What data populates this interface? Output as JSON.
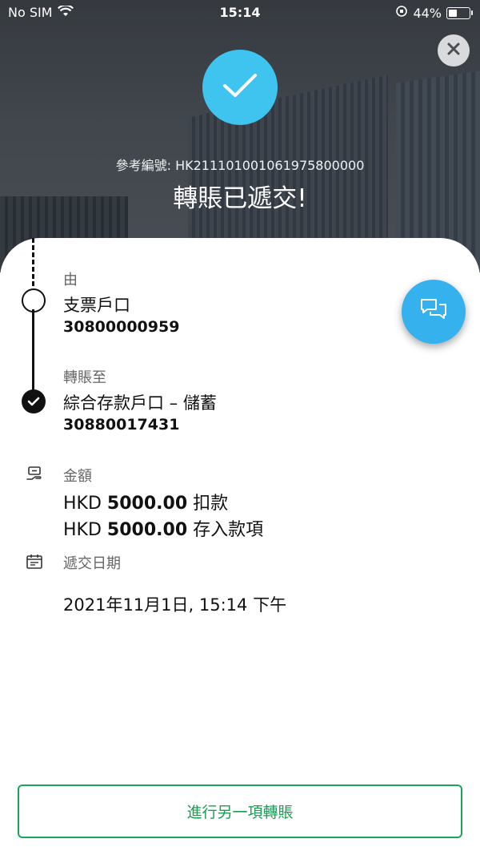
{
  "status_bar": {
    "carrier": "No SIM",
    "time": "15:14",
    "battery_percent": "44%",
    "battery_level": 0.44
  },
  "header": {
    "reference": "參考編號: HK211101001061975800000",
    "title": "轉賬已遞交!"
  },
  "transfer": {
    "from_label": "由",
    "from_account_name": "支票戶口",
    "from_account_number": "30800000959",
    "to_label": "轉賬至",
    "to_account_name": "綜合存款戶口 – 儲蓄",
    "to_account_number": "30880017431"
  },
  "amount": {
    "label": "金額",
    "debit_currency": "HKD",
    "debit_value": "5000.00",
    "debit_suffix": "扣款",
    "credit_currency": "HKD",
    "credit_value": "5000.00",
    "credit_suffix": "存入款項"
  },
  "submission": {
    "label": "遞交日期",
    "datetime": "2021年11月1日, 15:14 下午"
  },
  "actions": {
    "new_transfer": "進行另一項轉賬"
  },
  "colors": {
    "accent_blue": "#3fc3ef",
    "chat_blue": "#35b2ee",
    "action_green": "#1a9d52"
  },
  "icons": {
    "close": "close-icon",
    "success": "check-icon",
    "chat": "chat-bubbles-icon",
    "amount": "money-hand-icon",
    "date": "calendar-icon"
  }
}
